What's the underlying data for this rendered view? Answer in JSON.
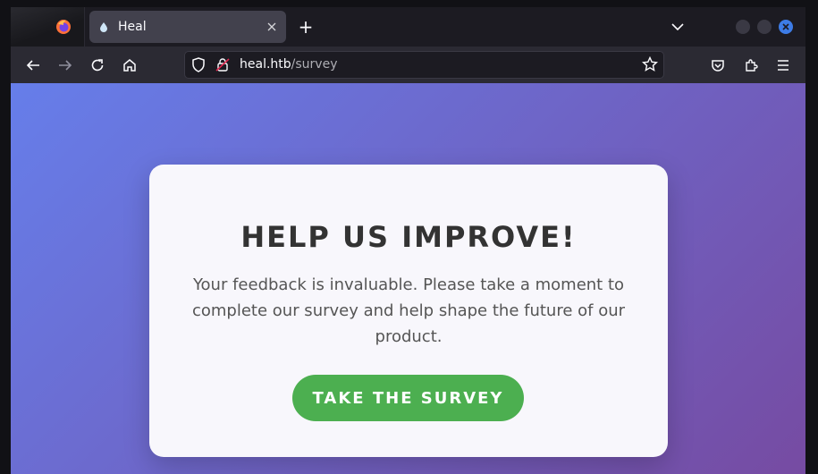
{
  "browser": {
    "tab": {
      "title": "Heal",
      "favicon": "water-drop-icon"
    },
    "new_tab": "+",
    "url": {
      "host": "heal.htb",
      "path": "/survey"
    },
    "colors": {
      "tab_bg": "#42414d",
      "toolbar_bg": "#2b2a33",
      "close_accent": "#3d7ce6"
    }
  },
  "page": {
    "heading": "HELP US IMPROVE!",
    "body": "Your feedback is invaluable. Please take a moment to complete our survey and help shape the future of our product.",
    "cta_label": "TAKE THE SURVEY",
    "colors": {
      "gradient_start": "#667eea",
      "gradient_end": "#764ba2",
      "button": "#4caf50"
    }
  }
}
